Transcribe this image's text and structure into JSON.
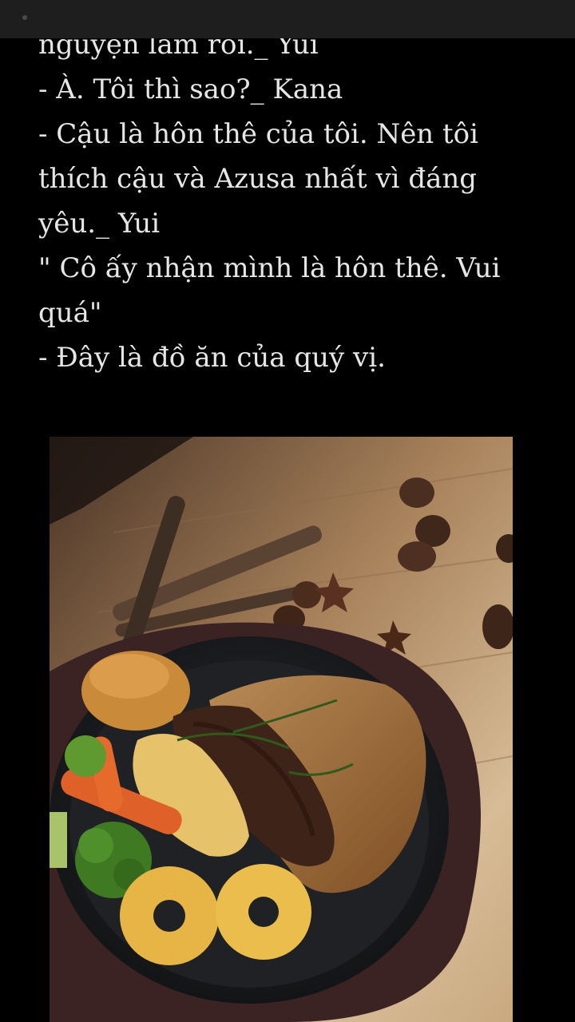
{
  "story": {
    "lines": [
      "nguyện lắm rồi._ Yui",
      "- À. Tôi thì sao?_ Kana",
      "- Cậu là hôn thê của tôi. Nên tôi",
      "thích cậu và Azusa nhất vì đáng",
      "yêu._ Yui",
      "\" Cô ấy nhận mình là hôn thê. Vui",
      "quá\"",
      "- Đây là đồ ăn của quý vị."
    ]
  },
  "image": {
    "subject": "steak-with-sauce-on-cast-iron-skillet",
    "colors": {
      "wood": "#b08a62",
      "board": "#3a2322",
      "skillet": "#1b1d20",
      "sauce": "#9b6a3a",
      "steak": "#3e2418",
      "pineapple": "#e7b545",
      "broccoli": "#3f7a22",
      "carrot": "#e0602a",
      "bun": "#c98a3a"
    }
  }
}
